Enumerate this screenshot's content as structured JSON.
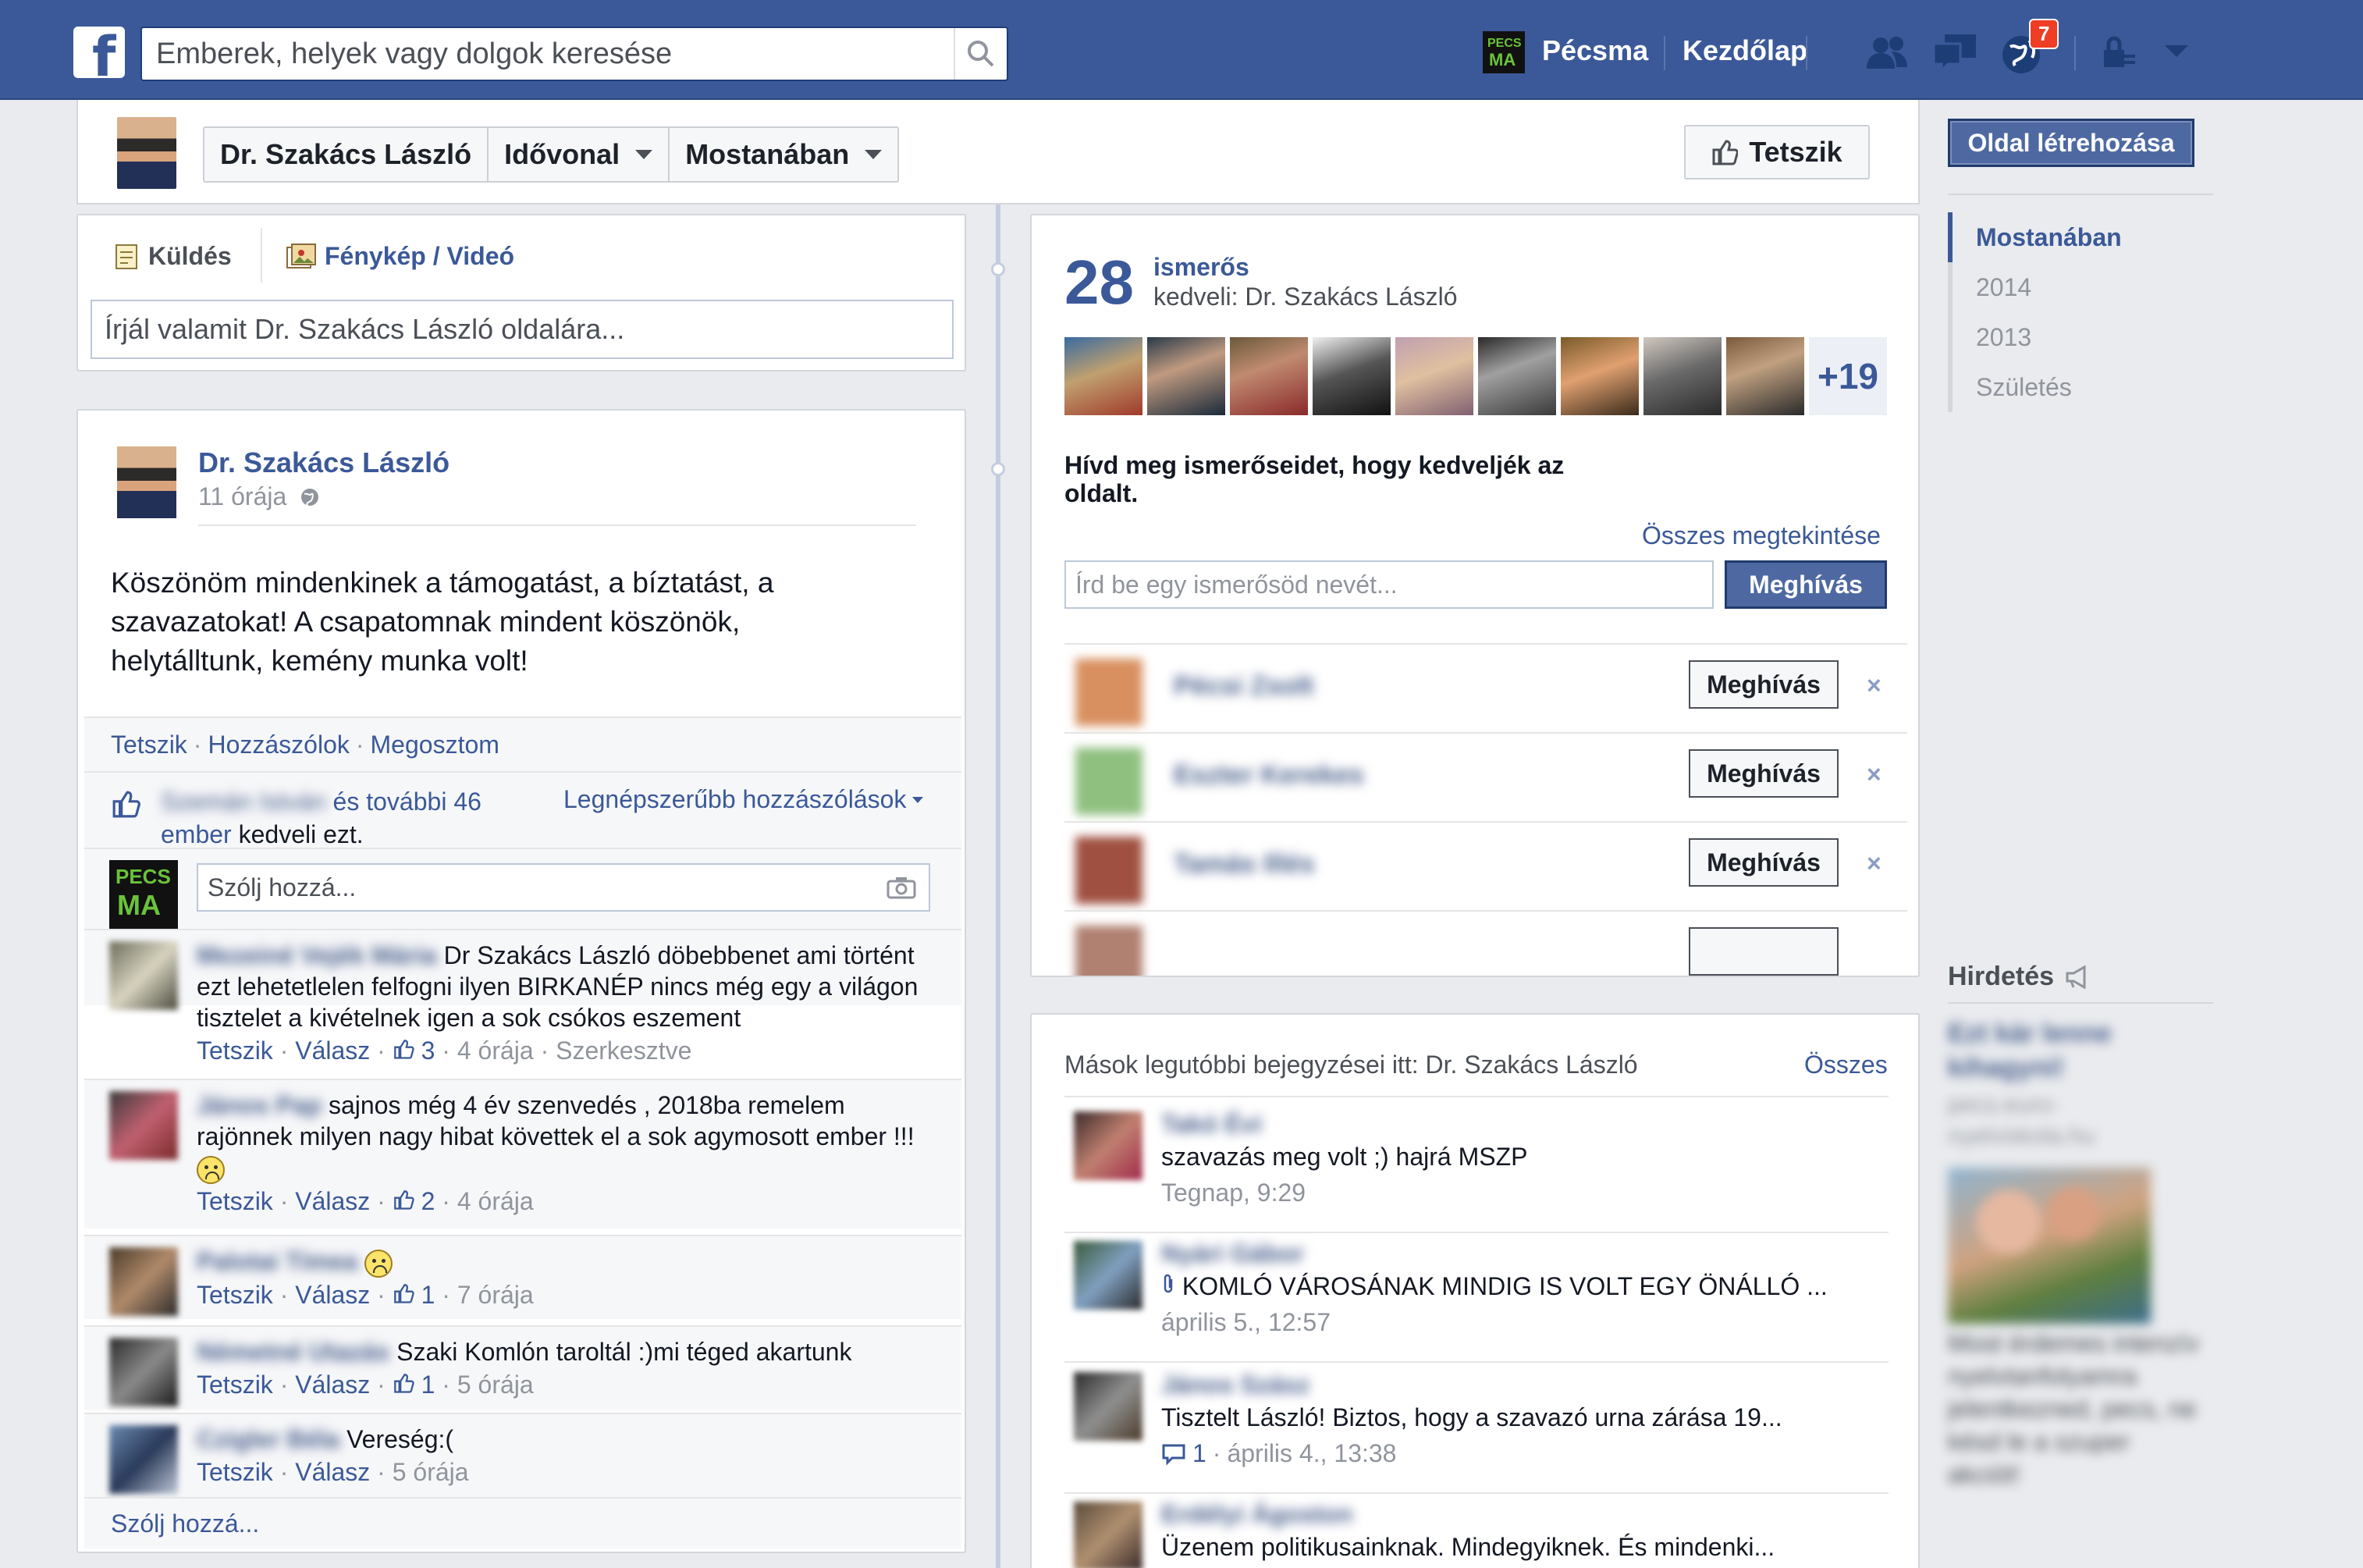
{
  "topbar": {
    "search_placeholder": "Emberek, helyek vagy dolgok keresése",
    "page_shortcut": "Pécsma",
    "home": "Kezdőlap",
    "notification_count": "7",
    "accent_color": "#3b5998"
  },
  "header": {
    "page_name": "Dr. Szakács László",
    "timeline_menu": "Idővonal",
    "recent_menu": "Mostanában",
    "like_button": "Tetszik"
  },
  "composer": {
    "tab_post": "Küldés",
    "tab_photo": "Fénykép / Videó",
    "placeholder": "Írjál valamit Dr. Szakács László oldalára..."
  },
  "post": {
    "author": "Dr. Szakács László",
    "time": "11 órája",
    "text": "Köszönöm mindenkinek a támogatást, a bíztatást, a szavazatokat! A csapatomnak mindent köszönök, helytálltunk, kemény munka volt!",
    "actions": {
      "like": "Tetszik",
      "comments": "Hozzászólok",
      "share": "Megosztom"
    },
    "likes": {
      "names": "Szemán István",
      "rest": "és további 46",
      "people": "ember",
      "suffix": "kedveli ezt."
    },
    "sort_label": "Legnépszerűbb hozzászólások",
    "comment_placeholder": "Szólj hozzá...",
    "comments": [
      {
        "name": "Mezeiné Vejék Mária",
        "text": "Dr Szakács László döbebbenet ami történt ezt lehetetlelen felfogni ilyen BIRKANÉP nincs még egy a világon tisztelet a kivételnek igen a sok csókos eszement",
        "like": "Tetszik",
        "reply": "Válasz",
        "likes": "3",
        "time": "4 órája",
        "edited": "Szerkesztve"
      },
      {
        "name": "János Pap",
        "text": "sajnos még 4 év szenvedés , 2018ba remelem rajönnek milyen nagy hibat követtek el a sok agymosott ember !!!",
        "like": "Tetszik",
        "reply": "Válasz",
        "likes": "2",
        "time": "4 órája"
      },
      {
        "name": "Palotai Tímea",
        "text": "",
        "like": "Tetszik",
        "reply": "Válasz",
        "likes": "1",
        "time": "7 órája"
      },
      {
        "name": "Németné Utazás",
        "text": "Szaki Komlón taroltál :)mi téged akartunk",
        "like": "Tetszik",
        "reply": "Válasz",
        "likes": "1",
        "time": "5 órája"
      },
      {
        "name": "Czigler Béla",
        "text": "Vereség:(",
        "like": "Tetszik",
        "reply": "Válasz",
        "time": "5 órája"
      }
    ],
    "write_comment": "Szólj hozzá..."
  },
  "friends": {
    "count": "28",
    "word": "ismerős",
    "likes_line": "kedveli: Dr. Szakács László",
    "more": "+19",
    "invite_prompt": "Hívd meg ismerőseidet, hogy kedveljék az oldalt.",
    "see_all": "Összes megtekintése",
    "input_placeholder": "Írd be egy ismerősöd nevét...",
    "invite_button": "Meghívás",
    "suggestions": [
      {
        "name": "Pécsi Zsolt",
        "button": "Meghívás"
      },
      {
        "name": "Eszter Kerekes",
        "button": "Meghívás"
      },
      {
        "name": "Tamás Illés",
        "button": "Meghívás"
      }
    ]
  },
  "recent": {
    "title": "Mások legutóbbi bejegyzései itt: Dr. Szakács László",
    "all": "Összes",
    "posts": [
      {
        "name": "Takó Évi",
        "text": "szavazás meg volt ;) hajrá MSZP",
        "time": "Tegnap, 9:29"
      },
      {
        "name": "Nyári Gábor",
        "text": "KOMLÓ VÁROSÁNAK MINDIG IS VOLT EGY ÖNÁLLÓ ...",
        "time": "április 5., 12:57"
      },
      {
        "name": "János Szász",
        "text": "Tisztelt László! Biztos, hogy a szavazó urna zárása 19...",
        "comments": "1",
        "time": "április 4., 13:38"
      },
      {
        "name": "Erdélyi Ágoston",
        "text": "Üzenem politikusainknak. Mindegyiknek. És mindenki..."
      }
    ]
  },
  "rail": {
    "create_page": "Oldal létrehozása",
    "timeline": [
      "Mostanában",
      "2014",
      "2013",
      "Születés"
    ],
    "ads_title": "Hirdetés",
    "ad_title": "Ezt kár lenne kihagyni!",
    "ad_domain": "pecs.euro-nyelviskola.hu",
    "ad_text": "Most érdemes intenzív nyelvtanfolyamra jelentkezned, pecs, ne késd le a szuper akciót!"
  }
}
